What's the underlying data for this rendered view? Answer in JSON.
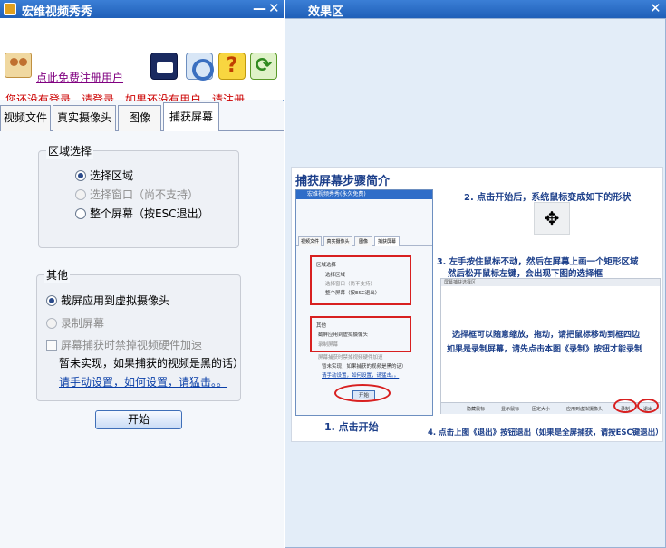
{
  "left_window": {
    "title": "宏维视频秀秀",
    "min_label": "—",
    "close_label": "✕"
  },
  "user": {
    "register_link": "点此免费注册用户",
    "login_message": "您还没有登录，请登录，如果还没有用户，请注册"
  },
  "toolbar": {
    "help_glyph": "?",
    "refresh_glyph": "⟳"
  },
  "tabs": [
    {
      "label": "视频文件"
    },
    {
      "label": "真实摄像头"
    },
    {
      "label": "图像"
    },
    {
      "label": "捕获屏幕"
    }
  ],
  "active_tab": "捕获屏幕",
  "region": {
    "legend": "区域选择",
    "options": [
      {
        "label": "选择区域",
        "selected": true,
        "enabled": true
      },
      {
        "label": "选择窗口（尚不支持）",
        "selected": false,
        "enabled": false
      },
      {
        "label": "整个屏幕（按ESC退出）",
        "selected": false,
        "enabled": true
      }
    ]
  },
  "other": {
    "legend": "其他",
    "options": [
      {
        "label": "截屏应用到虚拟摄像头",
        "selected": true,
        "enabled": true
      },
      {
        "label": "录制屏幕",
        "selected": false,
        "enabled": false
      }
    ],
    "checkbox_label": "屏幕捕获时禁掉视频硬件加速",
    "checkbox_checked": false,
    "note": "暂未实现，如果捕获的视频是黑的话）",
    "help_link": "请手动设置，如何设置，请猛击。。"
  },
  "start_button": "开始",
  "right_window": {
    "title": "效果区",
    "close_label": "✕"
  },
  "guide": {
    "title": "捕获屏幕步骤简介",
    "mini_window_title": "宏维视频秀秀(永久免费)",
    "mini_tabs": [
      "视频文件",
      "真实摄像头",
      "图像",
      "捕获屏幕"
    ],
    "mini_region_legend": "区域选择",
    "mini_region_opts": [
      "选择区域",
      "选择窗口（尚不支持）",
      "整个屏幕（按ESC退出）"
    ],
    "mini_other_legend": "其他",
    "mini_other_opts": [
      "截屏应用到虚拟摄像头",
      "录制屏幕"
    ],
    "mini_chk": "屏幕捕获时禁掉视频硬件加速",
    "mini_note": "暂未实现，如果捕获的视频是黑的话）",
    "mini_link": "请手动设置，如何设置，请猛击。。",
    "mini_start": "开始",
    "step1": "1. 点击开始",
    "step2": "2. 点击开始后，系统鼠标变成如下的形状",
    "step3_line1": "3. 左手按住鼠标不动，然后在屏幕上画一个矩形区域",
    "step3_line2": "然后松开鼠标左键，会出现下图的选择框",
    "sel_frame_title": "屏幕捕获选择区",
    "sel_note_line1": "选择框可以随意缩放，拖动，请把鼠标移动到框四边",
    "sel_note_line2": "如果是录制屏幕，请先点击本图《录制》按钮才能录制",
    "sel_toolbar_items": [
      "隐藏鼠标",
      "显示鼠标",
      "固定大小",
      "应用到虚拟摄像头",
      "录制",
      "退出"
    ],
    "step4": "4. 点击上图《退出》按钮退出（如果是全屏捕获，请按ESC键退出）"
  },
  "colors": {
    "title_bar": "#2468c8",
    "link_purple": "#800080",
    "warning_red": "#cc0000",
    "guide_blue": "#1c3f8a",
    "highlight_red": "#d82020"
  },
  "icons": {
    "user": "user-group-icon",
    "camera": "clapper-camera-icon",
    "settings": "gear-icon",
    "help": "question-icon",
    "refresh": "refresh-icon",
    "cursor": "crosshair-cursor-icon"
  }
}
